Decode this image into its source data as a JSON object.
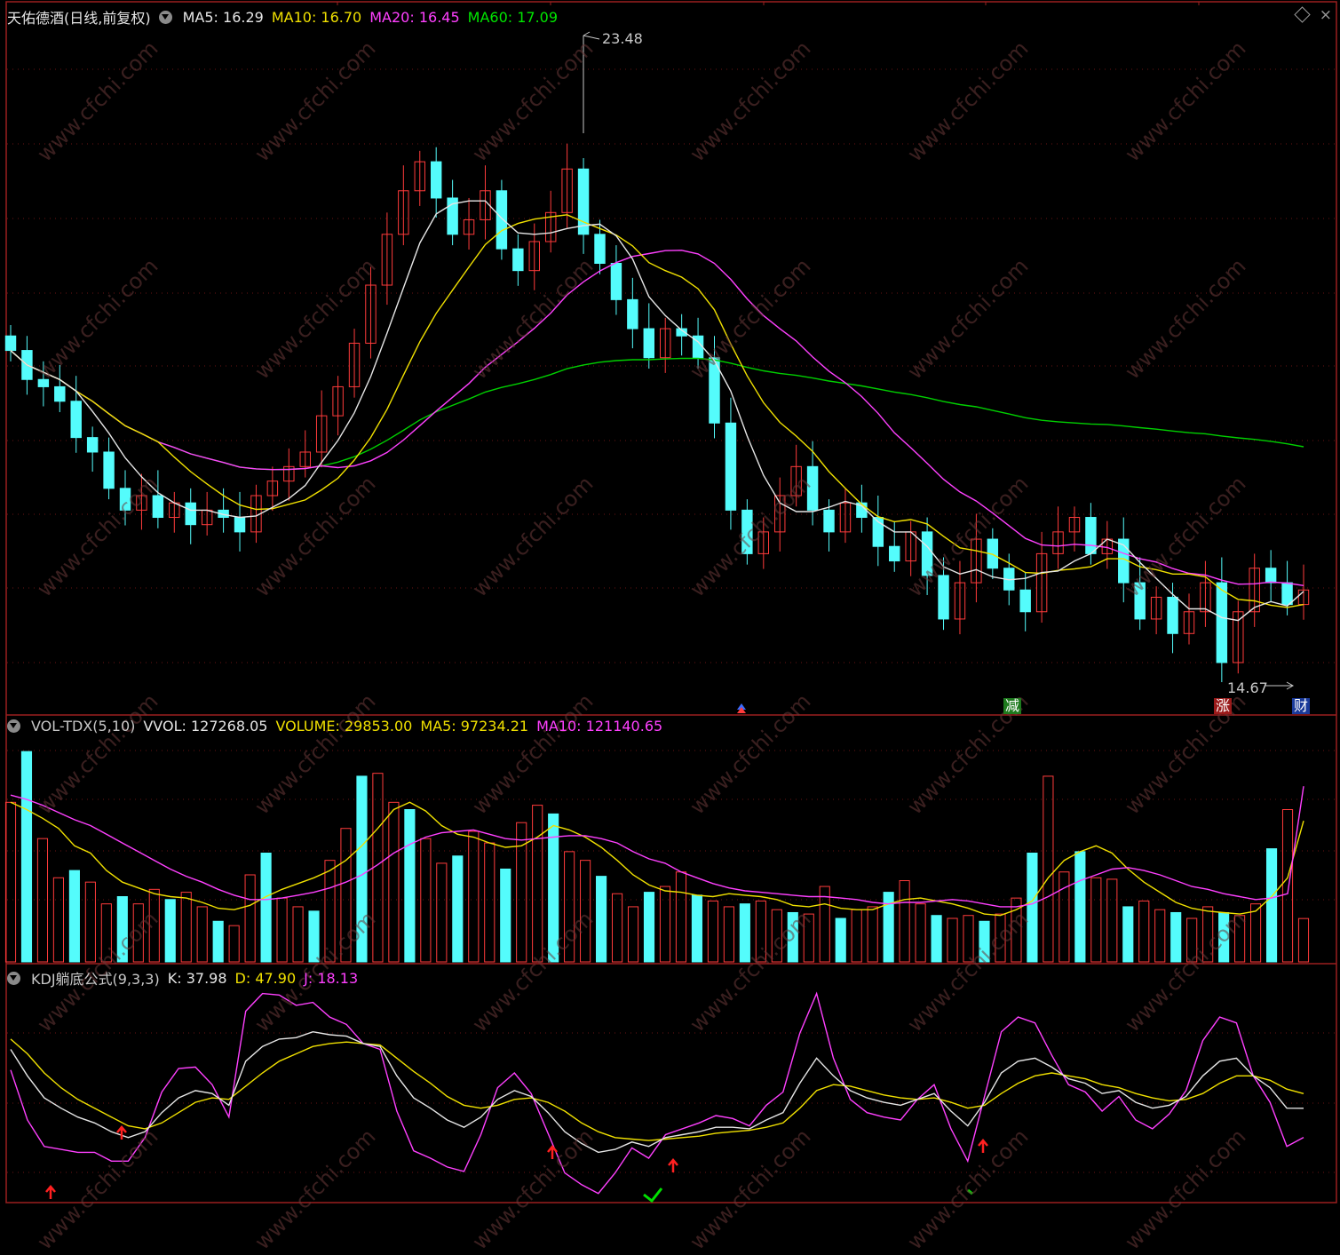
{
  "stock": {
    "name": "天佑德酒",
    "mode": "(日线,前复权)"
  },
  "price_legend": [
    {
      "label": "MA5:",
      "value": "16.29",
      "color": "#e6e6e6"
    },
    {
      "label": "MA10:",
      "value": "16.70",
      "color": "#f0e000"
    },
    {
      "label": "MA20:",
      "value": "16.45",
      "color": "#ff40ff"
    },
    {
      "label": "MA60:",
      "value": "17.09",
      "color": "#00e600"
    }
  ],
  "vol_legend": {
    "name": "VOL-TDX(5,10)",
    "vvol": "VVOL: 127268.05",
    "volume": "VOLUME: 29853.00",
    "ma5": "MA5: 97234.21",
    "ma10": "MA10: 121140.65"
  },
  "kdj_legend": {
    "name": "KDJ躺底公式(9,3,3)",
    "k": "K: 37.98",
    "d": "D: 47.90",
    "j": "J: 18.13"
  },
  "annotations": {
    "high": "23.48",
    "low": "14.67"
  },
  "event_tags": [
    {
      "label": "减",
      "bg": "#1e7a1e",
      "fg": "#ffffff"
    },
    {
      "label": "涨",
      "bg": "#9a1a1a",
      "fg": "#ffffff"
    },
    {
      "label": "财",
      "bg": "#1a3a9a",
      "fg": "#ffffff"
    }
  ],
  "watermark": "www.cfchi.com",
  "chart_data": [
    {
      "type": "candlestick",
      "series": [
        {
          "name": "收盘",
          "values": [
            19.4,
            19.0,
            18.9,
            18.7,
            18.2,
            18.0,
            17.5,
            17.2,
            17.4,
            17.1,
            17.3,
            17.0,
            17.2,
            17.1,
            16.9,
            17.4,
            17.6,
            17.8,
            18.0,
            18.5,
            18.9,
            19.5,
            20.3,
            21.0,
            21.6,
            22.0,
            21.5,
            21.0,
            21.2,
            21.6,
            20.8,
            20.5,
            20.9,
            21.3,
            21.9,
            21.0,
            20.6,
            20.1,
            19.7,
            19.3,
            19.7,
            19.6,
            19.3,
            18.4,
            17.2,
            16.6,
            16.9,
            17.4,
            17.8,
            17.2,
            16.9,
            17.3,
            17.1,
            16.7,
            16.5,
            16.9,
            16.3,
            15.7,
            16.2,
            16.8,
            16.4,
            16.1,
            15.8,
            16.6,
            16.9,
            17.1,
            16.6,
            16.8,
            16.2,
            15.7,
            16.0,
            15.5,
            15.8,
            16.2,
            15.1,
            15.8,
            16.4,
            16.2,
            15.9,
            16.1
          ]
        }
      ]
    },
    {
      "type": "bar",
      "series": [
        {
          "name": "VOLUME",
          "values": [
            110,
            145,
            85,
            58,
            63,
            55,
            40,
            45,
            40,
            50,
            43,
            48,
            38,
            28,
            25,
            60,
            75,
            44,
            38,
            35,
            70,
            92,
            128,
            130,
            110,
            105,
            85,
            68,
            73,
            90,
            82,
            64,
            96,
            108,
            102,
            76,
            70,
            59,
            47,
            38,
            48,
            52,
            62,
            46,
            42,
            38,
            40,
            42,
            36,
            34,
            33,
            52,
            30,
            36,
            38,
            48,
            56,
            40,
            32,
            30,
            32,
            28,
            33,
            44,
            75,
            128,
            62,
            76,
            58,
            57,
            38,
            42,
            36,
            34,
            30,
            38,
            34,
            32,
            40,
            78,
            105,
            29.9
          ]
        },
        {
          "name": "MA5",
          "values": [
            110,
            105,
            99,
            92,
            80,
            75,
            63,
            55,
            51,
            47,
            45,
            44,
            41,
            37,
            36,
            39,
            45,
            50,
            54,
            58,
            63,
            70,
            80,
            92,
            105,
            110,
            104,
            94,
            88,
            86,
            82,
            79,
            80,
            86,
            94,
            91,
            86,
            79,
            70,
            60,
            53,
            49,
            48,
            46,
            45,
            47,
            46,
            45,
            43,
            39,
            38,
            40,
            37,
            36,
            36,
            40,
            43,
            44,
            42,
            40,
            37,
            33,
            32,
            36,
            42,
            58,
            70,
            76,
            80,
            75,
            64,
            55,
            48,
            41,
            37,
            35,
            34,
            33,
            35,
            45,
            58,
            97.2
          ]
        },
        {
          "name": "MA10",
          "values": [
            115,
            112,
            108,
            103,
            98,
            94,
            88,
            82,
            76,
            70,
            64,
            59,
            55,
            50,
            46,
            43,
            43,
            44,
            46,
            48,
            51,
            55,
            60,
            67,
            75,
            81,
            86,
            89,
            90,
            91,
            88,
            85,
            84,
            85,
            86,
            87,
            87,
            85,
            82,
            76,
            71,
            68,
            62,
            58,
            54,
            51,
            49,
            48,
            47,
            46,
            45,
            45,
            44,
            43,
            41,
            40,
            41,
            41,
            42,
            43,
            42,
            40,
            38,
            38,
            40,
            45,
            51,
            56,
            60,
            64,
            65,
            63,
            60,
            56,
            52,
            50,
            47,
            45,
            43,
            44,
            47,
            121.1
          ]
        }
      ]
    },
    {
      "type": "line",
      "series": [
        {
          "name": "K",
          "values": [
            78,
            60,
            45,
            38,
            32,
            28,
            22,
            18,
            22,
            35,
            45,
            50,
            48,
            40,
            70,
            80,
            85,
            86,
            90,
            88,
            87,
            82,
            80,
            60,
            45,
            38,
            30,
            25,
            32,
            44,
            50,
            46,
            35,
            22,
            14,
            8,
            10,
            15,
            12,
            18,
            20,
            22,
            25,
            25,
            24,
            30,
            35,
            55,
            72,
            60,
            50,
            45,
            42,
            40,
            44,
            48,
            36,
            26,
            42,
            62,
            70,
            72,
            66,
            58,
            55,
            48,
            50,
            42,
            38,
            40,
            46,
            60,
            70,
            72,
            60,
            52,
            38,
            37.98
          ]
        },
        {
          "name": "D",
          "values": [
            85,
            75,
            62,
            52,
            44,
            38,
            32,
            26,
            24,
            28,
            35,
            42,
            45,
            44,
            53,
            62,
            70,
            75,
            80,
            82,
            83,
            82,
            81,
            72,
            63,
            55,
            46,
            40,
            38,
            40,
            44,
            45,
            42,
            36,
            28,
            22,
            18,
            17,
            16,
            17,
            18,
            19,
            21,
            22,
            23,
            25,
            28,
            38,
            50,
            54,
            53,
            50,
            47,
            45,
            44,
            45,
            42,
            38,
            40,
            48,
            55,
            60,
            62,
            60,
            58,
            54,
            52,
            48,
            45,
            43,
            44,
            48,
            55,
            60,
            60,
            57,
            51,
            47.9
          ]
        },
        {
          "name": "J",
          "values": [
            64,
            30,
            12,
            10,
            8,
            8,
            2,
            2,
            18,
            49,
            65,
            66,
            54,
            32,
            104,
            116,
            115,
            108,
            110,
            100,
            95,
            82,
            78,
            36,
            9,
            4,
            -2,
            -5,
            20,
            52,
            62,
            48,
            21,
            -6,
            -14,
            -20,
            -6,
            11,
            4,
            20,
            24,
            28,
            33,
            31,
            26,
            40,
            49,
            89,
            116,
            72,
            44,
            35,
            32,
            30,
            44,
            54,
            24,
            2,
            46,
            90,
            100,
            96,
            74,
            54,
            49,
            36,
            46,
            30,
            24,
            34,
            50,
            84,
            100,
            96,
            60,
            42,
            12,
            18.13
          ]
        }
      ]
    }
  ]
}
